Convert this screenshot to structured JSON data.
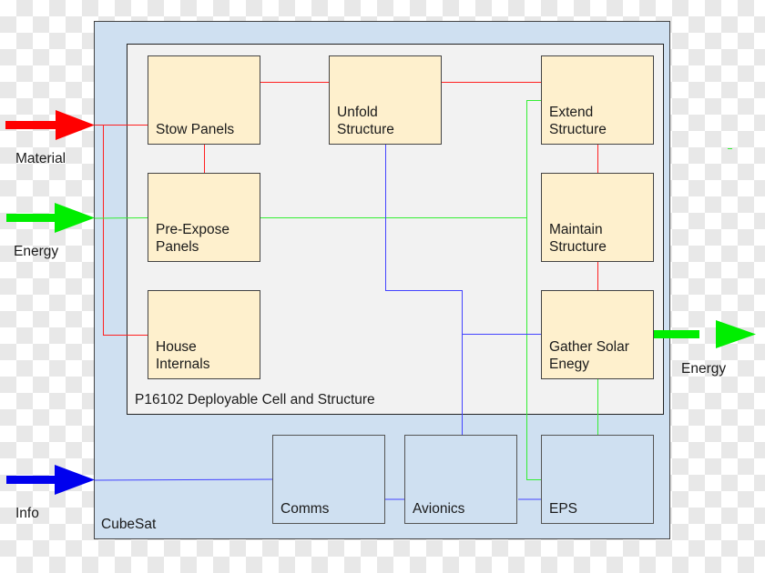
{
  "colors": {
    "material": "#ff0000",
    "energy": "#00ee00",
    "info": "#0000ff",
    "function_fill": "#fef0cd",
    "subsystem_fill": "#cfe0f1",
    "payload_fill": "#f2f2f2"
  },
  "containers": {
    "cubesat_label": "CubeSat",
    "payload_label": "P16102 Deployable Cell and Structure"
  },
  "functions": [
    {
      "id": "stow",
      "label": "Stow Panels"
    },
    {
      "id": "unfold",
      "label": "Unfold\nStructure"
    },
    {
      "id": "extend",
      "label": "Extend\nStructure"
    },
    {
      "id": "preexpose",
      "label": "Pre-Expose\nPanels"
    },
    {
      "id": "maintain",
      "label": "Maintain\nStructure"
    },
    {
      "id": "house",
      "label": "House\nInternals"
    },
    {
      "id": "gather",
      "label": "Gather Solar\nEnegy"
    }
  ],
  "subsystems": [
    {
      "id": "comms",
      "label": "Comms"
    },
    {
      "id": "avionics",
      "label": "Avionics"
    },
    {
      "id": "eps",
      "label": "EPS"
    }
  ],
  "flows": {
    "inputs": [
      {
        "label": "Material",
        "type": "material"
      },
      {
        "label": "Energy",
        "type": "energy"
      },
      {
        "label": "Info",
        "type": "info"
      }
    ],
    "outputs": [
      {
        "label": "Energy",
        "type": "energy"
      }
    ]
  }
}
